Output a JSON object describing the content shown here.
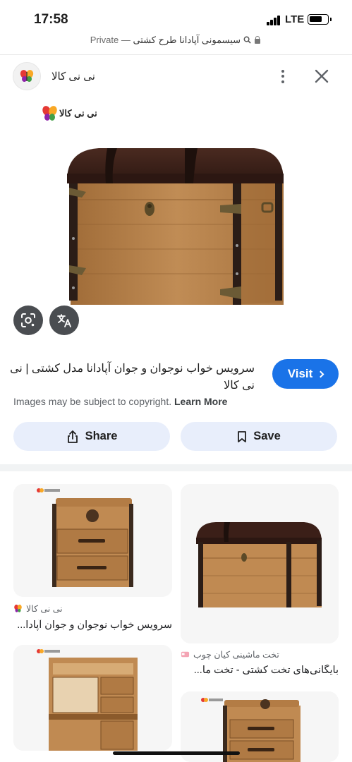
{
  "status_bar": {
    "time": "17:58",
    "network": "LTE"
  },
  "url_bar": {
    "query": "سیسمونی آپادانا طرح کشتی",
    "separator": "—",
    "mode": "Private"
  },
  "viewer": {
    "site_name": "نی نی کالا",
    "title": "سرویس خواب نوجوان و جوان آپادانا مدل کشتی | نی نی کالا",
    "visit_label": "Visit",
    "copyright_text": "Images may be subject to copyright.",
    "learn_more": "Learn More",
    "share_label": "Share",
    "save_label": "Save",
    "brand_logo_text": "نی نی کالا"
  },
  "results": [
    {
      "source": "نی نی کالا",
      "title": "سرویس خواب نوجوان و جوان آپادا...",
      "image": "wooden-nightstand"
    },
    {
      "source": "",
      "title": "",
      "image": "storage-chest"
    },
    {
      "source": "تخت ماشینی کیان چوب",
      "title": "بایگانی‌های تخت کشتی - تخت ما...",
      "image": "desk-bookshelf"
    },
    {
      "source": "",
      "title": "",
      "image": "wooden-nightstand-2"
    }
  ],
  "icons": {
    "lens": "google-lens-icon",
    "translate": "translate-icon",
    "more": "more-vertical-icon",
    "close": "close-icon",
    "share": "share-icon",
    "save": "bookmark-icon"
  },
  "colors": {
    "accent": "#1a73e8",
    "pill_bg": "#e8eefb",
    "wood": "#b5824a",
    "cushion": "#3b1f18"
  }
}
